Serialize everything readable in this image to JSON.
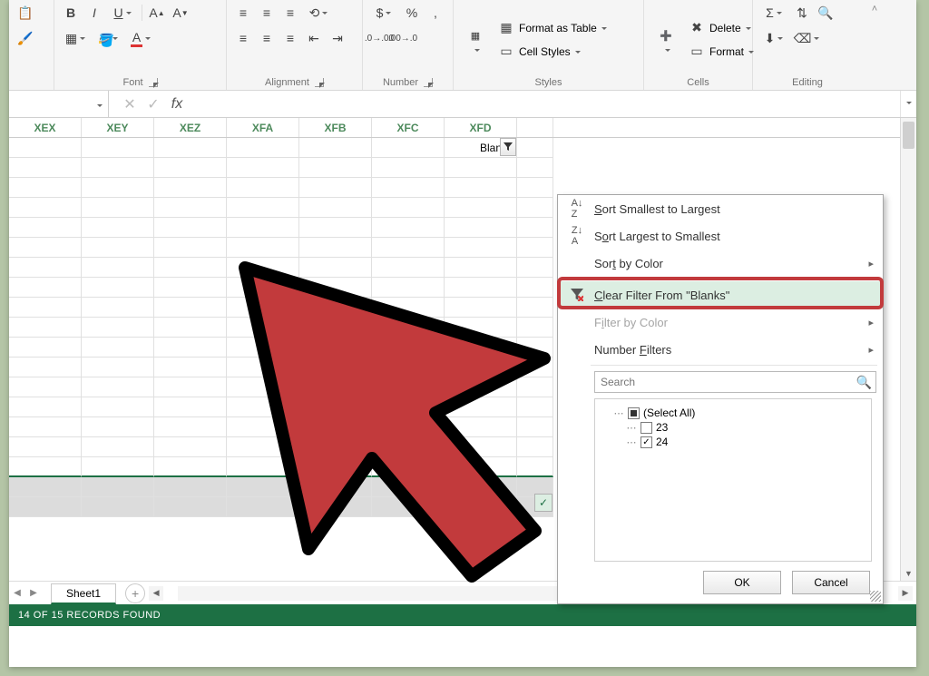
{
  "ribbon": {
    "groups": {
      "font": "Font",
      "alignment": "Alignment",
      "number": "Number",
      "styles": "Styles",
      "cells": "Cells",
      "editing": "Editing"
    },
    "styles_items": {
      "format_table": "Format as Table",
      "cell_styles": "Cell Styles"
    },
    "cells_items": {
      "delete": "Delete",
      "format": "Format"
    },
    "number_symbols": {
      "dollar": "$",
      "percent": "%",
      "comma": ","
    }
  },
  "formula_bar": {
    "fx": "fx",
    "value": ""
  },
  "columns": [
    "XEX",
    "XEY",
    "XEZ",
    "XFA",
    "XFB",
    "XFC",
    "XFD",
    ""
  ],
  "filtered_header": "Blanks",
  "sheet_tab": "Sheet1",
  "status_text": "14 OF 15 RECORDS FOUND",
  "filter_menu": {
    "sort_asc": "Sort Smallest to Largest",
    "sort_desc": "Sort Largest to Smallest",
    "sort_color": "Sort by Color",
    "clear": "Clear Filter From \"Blanks\"",
    "filter_color": "Filter by Color",
    "number_filters": "Number Filters",
    "search_placeholder": "Search",
    "select_all": "(Select All)",
    "items": [
      "23",
      "24"
    ],
    "ok": "OK",
    "cancel": "Cancel"
  }
}
